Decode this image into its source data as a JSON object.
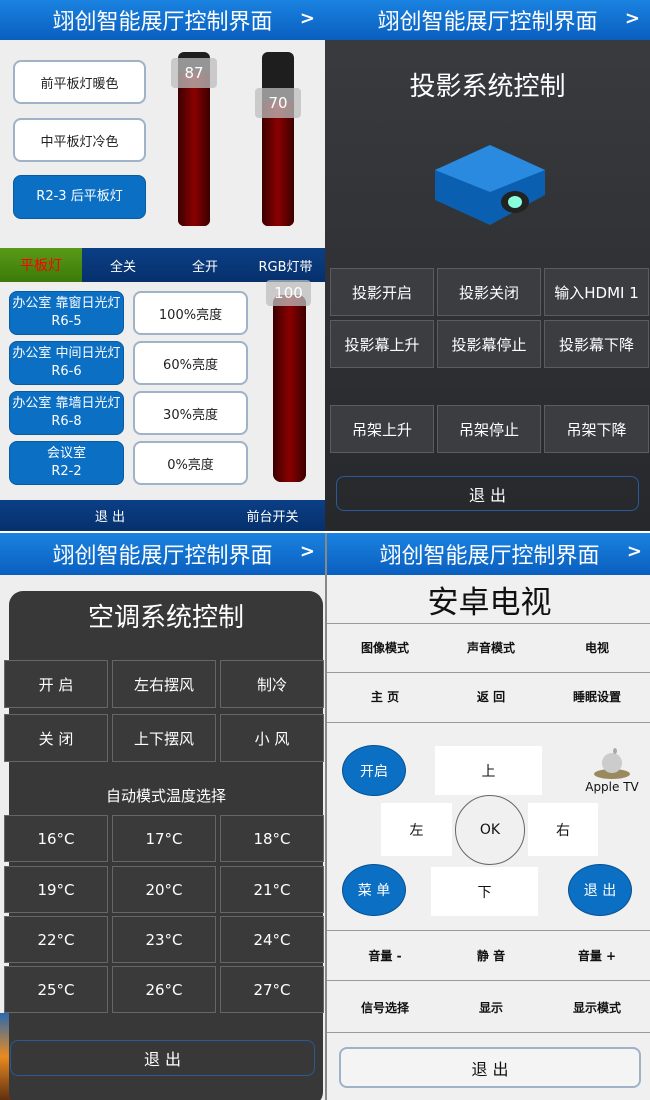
{
  "header": {
    "title": "翊创智能展厅控制界面",
    "chevron": ">"
  },
  "lighting": {
    "buttons": [
      "前平板灯暖色",
      "中平板灯冷色",
      "R2-3 后平板灯"
    ],
    "sliders": [
      {
        "value": 87
      },
      {
        "value": 70
      }
    ],
    "tabs": [
      "平板灯",
      "全关",
      "全开",
      "RGB灯带"
    ],
    "rows": [
      {
        "name": "办公室 靠窗日光灯",
        "code": "R6-5",
        "level": "100%亮度"
      },
      {
        "name": "办公室 中间日光灯",
        "code": "R6-6",
        "level": "60%亮度"
      },
      {
        "name": "办公室 靠墙日光灯",
        "code": "R6-8",
        "level": "30%亮度"
      },
      {
        "name": "会议室",
        "code": "R2-2",
        "level": "0%亮度"
      }
    ],
    "rgb_slider": {
      "value": 100
    },
    "exit": "退 出",
    "front": "前台开关",
    "colors": {
      "active_tab_bg": "#4a8a10",
      "active_tab_text": "#ff0000",
      "accent": "#0b6fc4"
    }
  },
  "projector": {
    "title": "投影系统控制",
    "icon": "projector-icon",
    "rows": [
      [
        "投影开启",
        "投影关闭",
        "输入HDMI 1"
      ],
      [
        "投影幕上升",
        "投影幕停止",
        "投影幕下降"
      ],
      [
        "吊架上升",
        "吊架停止",
        "吊架下降"
      ]
    ],
    "exit": "退 出"
  },
  "ac": {
    "title": "空调系统控制",
    "rows": [
      [
        "开 启",
        "左右摆风",
        "制冷"
      ],
      [
        "关 闭",
        "上下摆风",
        "小 风"
      ]
    ],
    "temp_label": "自动模式温度选择",
    "temps": [
      [
        "16°C",
        "17°C",
        "18°C"
      ],
      [
        "19°C",
        "20°C",
        "21°C"
      ],
      [
        "22°C",
        "23°C",
        "24°C"
      ],
      [
        "25°C",
        "26°C",
        "27°C"
      ]
    ],
    "exit": "退 出"
  },
  "tv": {
    "title": "安卓电视",
    "top_rows": [
      [
        "图像模式",
        "声音模式",
        "电视"
      ],
      [
        "主 页",
        "返 回",
        "睡眠设置"
      ]
    ],
    "remote": {
      "power": "开启",
      "up": "上",
      "left": "左",
      "ok": "OK",
      "right": "右",
      "menu": "菜 单",
      "down": "下",
      "exit": "退 出",
      "apple_tv": "Apple TV"
    },
    "bottom_rows": [
      [
        "音量 -",
        "静 音",
        "音量 +"
      ],
      [
        "信号选择",
        "显示",
        "显示模式"
      ]
    ],
    "exit": "退 出"
  }
}
